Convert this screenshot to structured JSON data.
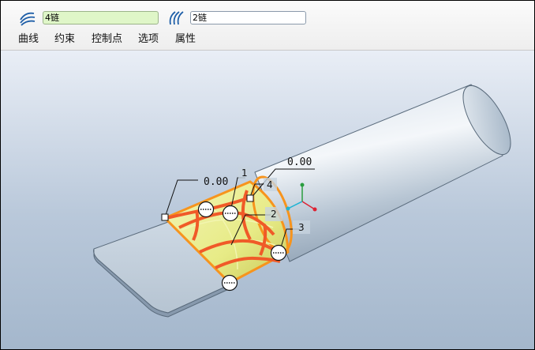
{
  "dashboard": {
    "collector_1": {
      "value": "4链",
      "icon": "curve-chain-icon"
    },
    "collector_2": {
      "value": "2链",
      "icon": "curve-chain-icon"
    }
  },
  "tabs": [
    {
      "label": "曲线"
    },
    {
      "label": "约束"
    },
    {
      "label": "控制点"
    },
    {
      "label": "选项"
    },
    {
      "label": "属性"
    }
  ],
  "graphics": {
    "dimensions": [
      "0.00",
      "0.00"
    ],
    "curve_ids": [
      "1",
      "2",
      "3",
      "4"
    ],
    "colors": {
      "surface": "#e8ec90",
      "selected_curves": "#f05a28",
      "boundary": "#f7941d",
      "model": "#cfdbe6",
      "background": "#b9c8da"
    }
  }
}
